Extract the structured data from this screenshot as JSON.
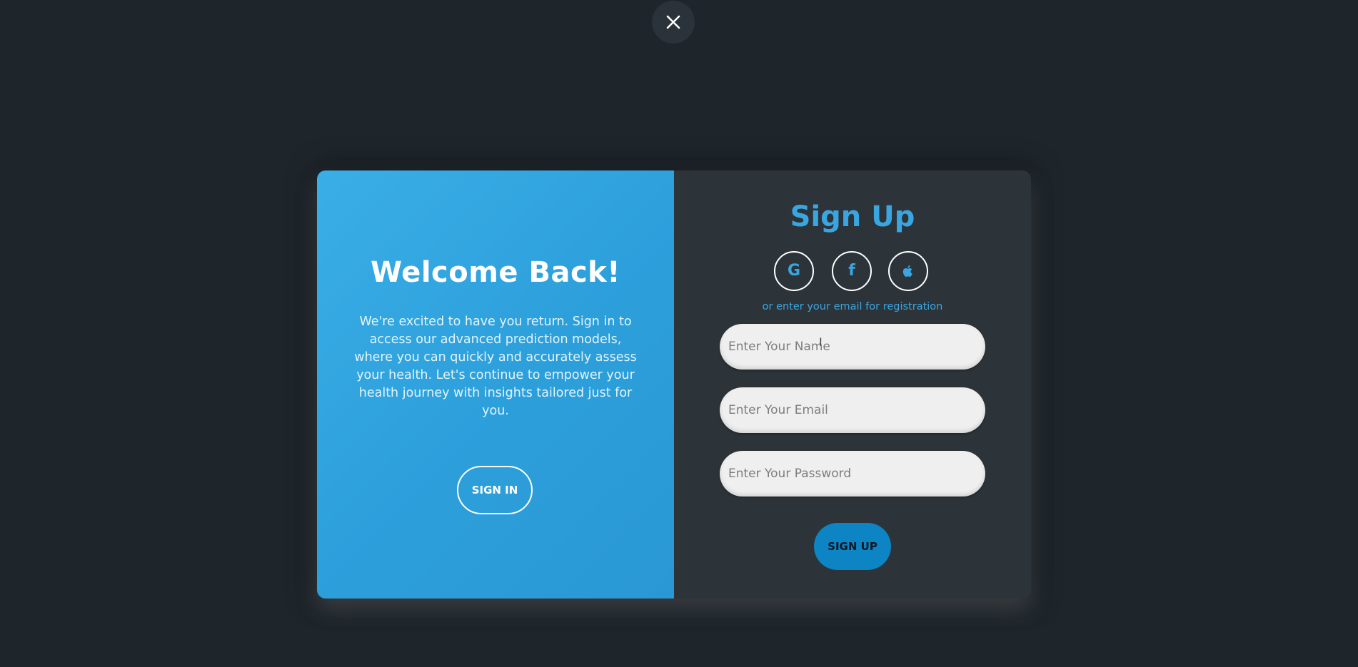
{
  "close_button": {
    "icon": "close-icon"
  },
  "left_panel": {
    "title": "Welcome Back!",
    "description": "We're excited to have you return. Sign in to access our advanced prediction models, where you can quickly and accurately assess your health. Let's continue to empower your health journey with insights tailored just for you.",
    "signin_label": "SIGN IN"
  },
  "right_panel": {
    "title": "Sign Up",
    "socials": [
      {
        "name": "google-icon",
        "glyph": "G"
      },
      {
        "name": "facebook-icon",
        "glyph": "f"
      },
      {
        "name": "apple-icon",
        "glyph": ""
      }
    ],
    "or_text": "or enter your email for registration",
    "fields": {
      "name_placeholder": "Enter Your Name",
      "email_placeholder": "Enter Your Email",
      "password_placeholder": "Enter Your Password"
    },
    "signup_label": "SIGN UP"
  },
  "colors": {
    "background": "#1e252b",
    "accent": "#3aa6e1",
    "left_panel": "#2c9fdb",
    "right_panel": "#2d3439",
    "signup_button": "#0d84c4"
  }
}
